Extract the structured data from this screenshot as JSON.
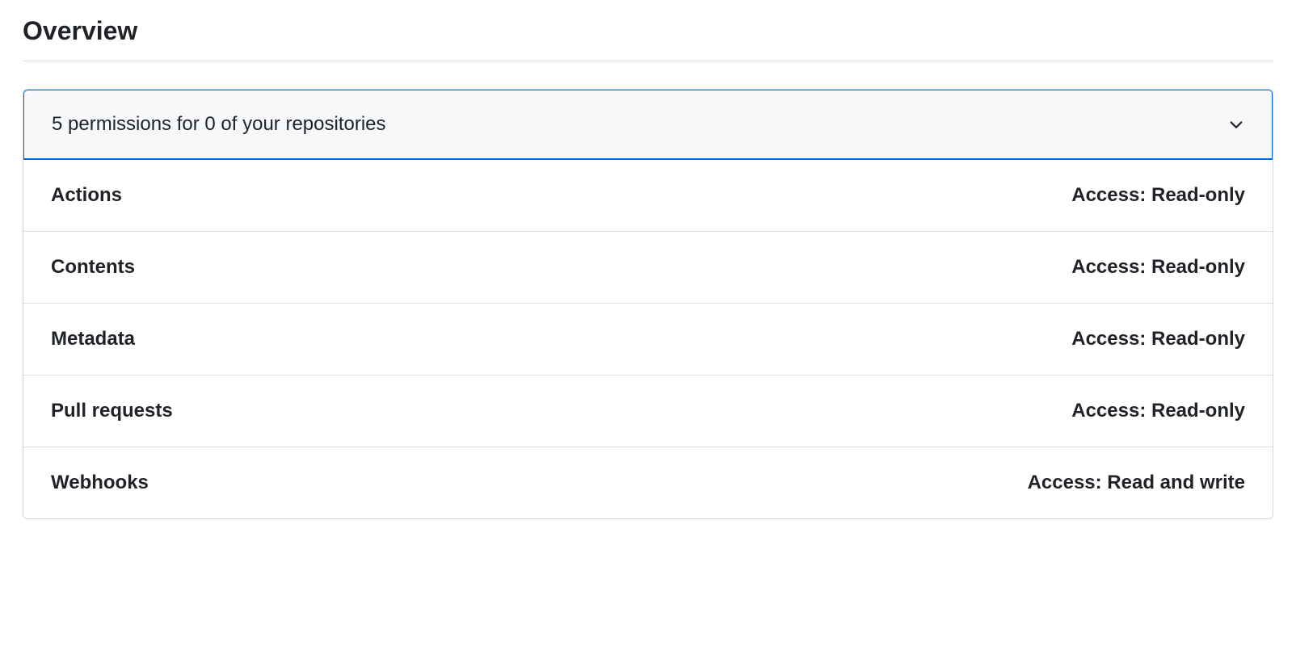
{
  "title": "Overview",
  "panel": {
    "summary": "5 permissions for 0 of your repositories",
    "permissions": [
      {
        "name": "Actions",
        "access": "Access: Read-only"
      },
      {
        "name": "Contents",
        "access": "Access: Read-only"
      },
      {
        "name": "Metadata",
        "access": "Access: Read-only"
      },
      {
        "name": "Pull requests",
        "access": "Access: Read-only"
      },
      {
        "name": "Webhooks",
        "access": "Access: Read and write"
      }
    ]
  }
}
